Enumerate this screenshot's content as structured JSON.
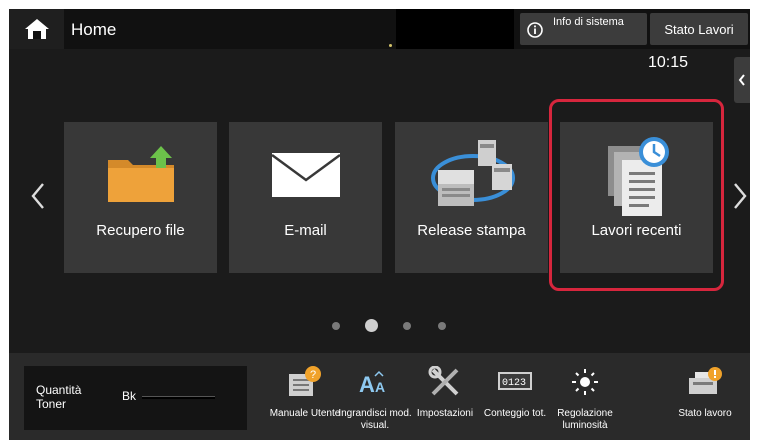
{
  "header": {
    "title": "Home",
    "info_label": "Info di sistema",
    "status_label": "Stato Lavori",
    "clock": "10:15"
  },
  "tiles": [
    {
      "label": "Recupero file",
      "icon": "folder-upload-icon"
    },
    {
      "label": "E-mail",
      "icon": "envelope-icon"
    },
    {
      "label": "Release stampa",
      "icon": "print-release-icon"
    },
    {
      "label": "Lavori recenti",
      "icon": "recent-jobs-icon"
    }
  ],
  "pager": {
    "current_page": 2,
    "total_pages": 4
  },
  "toner": {
    "label": "Quantità Toner",
    "color_label": "Bk"
  },
  "bottom_icons": [
    {
      "label": "Manuale Utente",
      "icon": "user-manual-icon"
    },
    {
      "label": "Ingrandisci mod. visual.",
      "icon": "text-enlarge-icon"
    },
    {
      "label": "Impostazioni",
      "icon": "settings-tools-icon"
    },
    {
      "label": "Conteggio tot.",
      "icon": "counter-icon",
      "counter_text": "0123"
    },
    {
      "label": "Regolazione luminosità",
      "icon": "brightness-icon"
    },
    {
      "label": "Stato lavoro",
      "icon": "job-status-icon"
    }
  ],
  "colors": {
    "accent": "#f0a22a",
    "highlight": "#d7263d",
    "tile": "#383838",
    "background": "#1b1b1b"
  }
}
